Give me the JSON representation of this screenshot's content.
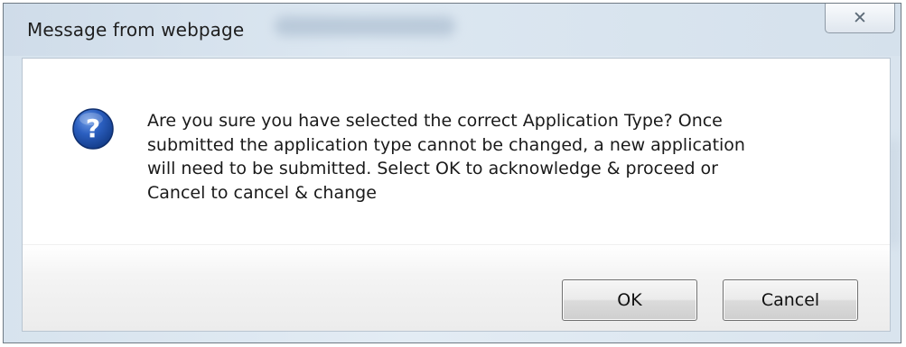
{
  "dialog": {
    "title": "Message from webpage",
    "close_glyph": "✕",
    "icon": "question-icon",
    "message": "Are you sure you have selected the correct Application Type? Once\nsubmitted the application type cannot be changed, a new application\nwill need to be submitted. Select OK to acknowledge & proceed or\nCancel to cancel & change",
    "ok_label": "OK",
    "cancel_label": "Cancel"
  },
  "colors": {
    "frame": "#d7e3ee",
    "icon_blue": "#1f4fa8",
    "content_bg": "#ffffff"
  }
}
